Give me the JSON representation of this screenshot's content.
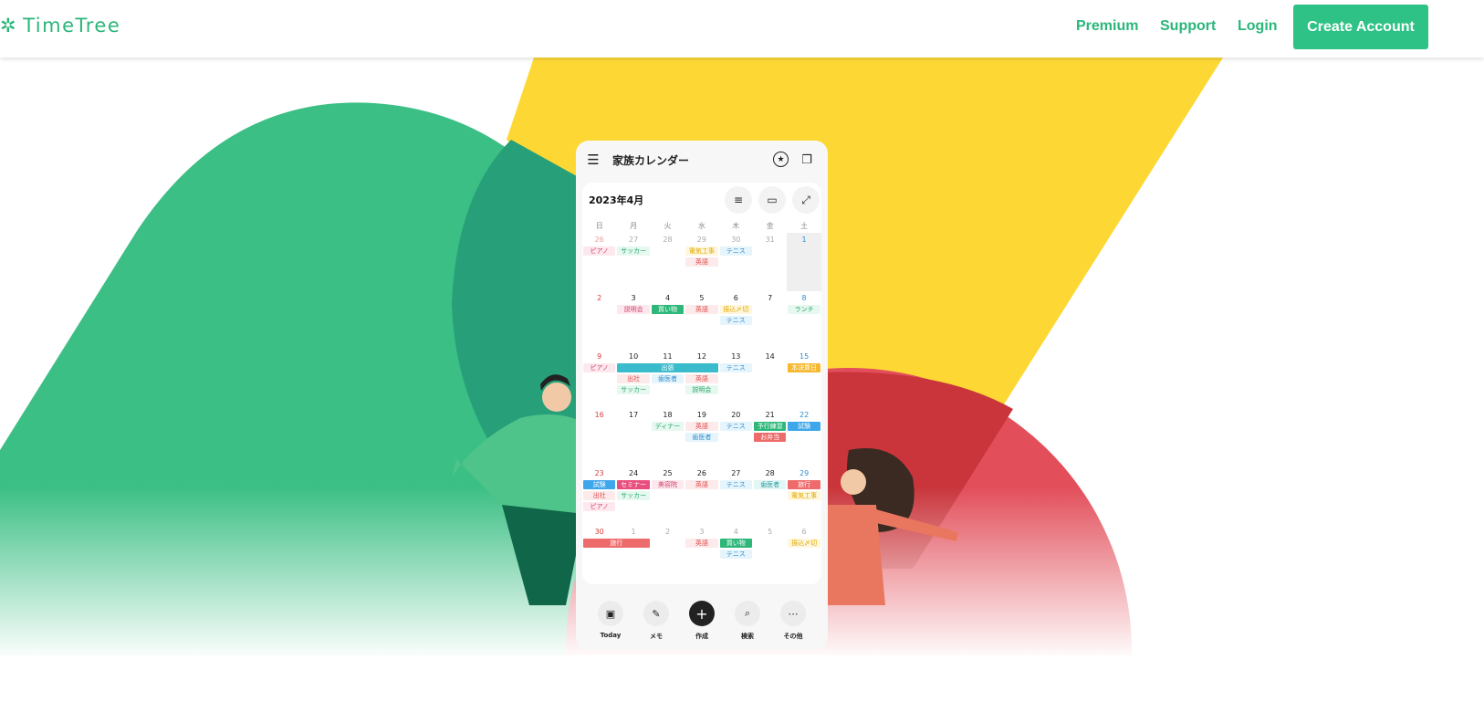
{
  "header": {
    "logo_text": "TimeTree",
    "nav": [
      "Premium",
      "Support",
      "Login"
    ],
    "cta": "Create Account",
    "brand_color": "#2bb67a"
  },
  "phone": {
    "title": "家族カレンダー",
    "month": "2023年4月",
    "weekdays": [
      "日",
      "月",
      "火",
      "水",
      "木",
      "金",
      "土"
    ],
    "weeks": [
      {
        "days": [
          "26",
          "27",
          "28",
          "29",
          "30",
          "31",
          "1"
        ],
        "muted": [
          0,
          1,
          2,
          3,
          4,
          5
        ],
        "events": [
          {
            "c": 0,
            "s": 1,
            "r": 0,
            "t": "ピアノ",
            "k": "pink"
          },
          {
            "c": 1,
            "s": 1,
            "r": 0,
            "t": "サッカー",
            "k": "green"
          },
          {
            "c": 3,
            "s": 1,
            "r": 0,
            "t": "電気工事",
            "k": "yellow"
          },
          {
            "c": 3,
            "s": 1,
            "r": 1,
            "t": "英語",
            "k": "red"
          },
          {
            "c": 4,
            "s": 1,
            "r": 0,
            "t": "テニス",
            "k": "blue"
          }
        ]
      },
      {
        "days": [
          "2",
          "3",
          "4",
          "5",
          "6",
          "7",
          "8"
        ],
        "muted": [],
        "events": [
          {
            "c": 1,
            "s": 1,
            "r": 0,
            "t": "説明会",
            "k": "pink"
          },
          {
            "c": 2,
            "s": 1,
            "r": 0,
            "t": "買い物",
            "k": "greenS"
          },
          {
            "c": 3,
            "s": 1,
            "r": 0,
            "t": "英語",
            "k": "red"
          },
          {
            "c": 4,
            "s": 1,
            "r": 0,
            "t": "振込〆切",
            "k": "yellow"
          },
          {
            "c": 4,
            "s": 1,
            "r": 1,
            "t": "テニス",
            "k": "blue"
          },
          {
            "c": 6,
            "s": 1,
            "r": 0,
            "t": "ランチ",
            "k": "green"
          }
        ]
      },
      {
        "days": [
          "9",
          "10",
          "11",
          "12",
          "13",
          "14",
          "15"
        ],
        "muted": [],
        "events": [
          {
            "c": 0,
            "s": 1,
            "r": 0,
            "t": "ピアノ",
            "k": "pink"
          },
          {
            "c": 1,
            "s": 3,
            "r": 0,
            "t": "出張",
            "k": "tealS"
          },
          {
            "c": 1,
            "s": 1,
            "r": 1,
            "t": "出社",
            "k": "red"
          },
          {
            "c": 2,
            "s": 1,
            "r": 1,
            "t": "歯医者",
            "k": "blue"
          },
          {
            "c": 3,
            "s": 1,
            "r": 1,
            "t": "英語",
            "k": "red"
          },
          {
            "c": 1,
            "s": 1,
            "r": 2,
            "t": "サッカー",
            "k": "green"
          },
          {
            "c": 3,
            "s": 1,
            "r": 2,
            "t": "説明会",
            "k": "green"
          },
          {
            "c": 4,
            "s": 1,
            "r": 0,
            "t": "テニス",
            "k": "blue"
          },
          {
            "c": 6,
            "s": 1,
            "r": 0,
            "t": "本決算日",
            "k": "yellowS"
          }
        ]
      },
      {
        "days": [
          "16",
          "17",
          "18",
          "19",
          "20",
          "21",
          "22"
        ],
        "muted": [],
        "events": [
          {
            "c": 2,
            "s": 1,
            "r": 0,
            "t": "ディナー",
            "k": "green"
          },
          {
            "c": 3,
            "s": 1,
            "r": 0,
            "t": "英語",
            "k": "red"
          },
          {
            "c": 3,
            "s": 1,
            "r": 1,
            "t": "歯医者",
            "k": "blue"
          },
          {
            "c": 4,
            "s": 1,
            "r": 0,
            "t": "テニス",
            "k": "blue"
          },
          {
            "c": 5,
            "s": 1,
            "r": 0,
            "t": "予行練習",
            "k": "greenS"
          },
          {
            "c": 5,
            "s": 1,
            "r": 1,
            "t": "お弁当",
            "k": "redS"
          },
          {
            "c": 6,
            "s": 1,
            "r": 0,
            "t": "試験",
            "k": "blueS"
          }
        ]
      },
      {
        "days": [
          "23",
          "24",
          "25",
          "26",
          "27",
          "28",
          "29"
        ],
        "muted": [],
        "events": [
          {
            "c": 0,
            "s": 1,
            "r": 0,
            "t": "試験",
            "k": "blueS"
          },
          {
            "c": 0,
            "s": 1,
            "r": 1,
            "t": "出社",
            "k": "red"
          },
          {
            "c": 0,
            "s": 1,
            "r": 2,
            "t": "ピアノ",
            "k": "pink"
          },
          {
            "c": 1,
            "s": 1,
            "r": 0,
            "t": "セミナー",
            "k": "pinkS"
          },
          {
            "c": 1,
            "s": 1,
            "r": 1,
            "t": "サッカー",
            "k": "green"
          },
          {
            "c": 2,
            "s": 1,
            "r": 0,
            "t": "美容院",
            "k": "pink"
          },
          {
            "c": 3,
            "s": 1,
            "r": 0,
            "t": "英語",
            "k": "red"
          },
          {
            "c": 4,
            "s": 1,
            "r": 0,
            "t": "テニス",
            "k": "blue"
          },
          {
            "c": 5,
            "s": 1,
            "r": 0,
            "t": "歯医者",
            "k": "teal"
          },
          {
            "c": 6,
            "s": 1,
            "r": 0,
            "t": "旅行",
            "k": "redS"
          },
          {
            "c": 6,
            "s": 1,
            "r": 1,
            "t": "電気工事",
            "k": "yellow"
          }
        ]
      },
      {
        "days": [
          "30",
          "1",
          "2",
          "3",
          "4",
          "5",
          "6"
        ],
        "muted": [
          1,
          2,
          3,
          4,
          5,
          6
        ],
        "events": [
          {
            "c": 0,
            "s": 2,
            "r": 0,
            "t": "旅行",
            "k": "redS"
          },
          {
            "c": 3,
            "s": 1,
            "r": 0,
            "t": "英語",
            "k": "red"
          },
          {
            "c": 4,
            "s": 1,
            "r": 0,
            "t": "買い物",
            "k": "greenS"
          },
          {
            "c": 4,
            "s": 1,
            "r": 1,
            "t": "テニス",
            "k": "blue"
          },
          {
            "c": 6,
            "s": 1,
            "r": 0,
            "t": "振込〆切",
            "k": "yellow"
          }
        ]
      }
    ],
    "bottom": [
      "Today",
      "メモ",
      "作成",
      "検索",
      "その他"
    ]
  },
  "colors": {
    "green": "#3bbf84",
    "yellow": "#fdd835",
    "red": "#e24e5a"
  }
}
